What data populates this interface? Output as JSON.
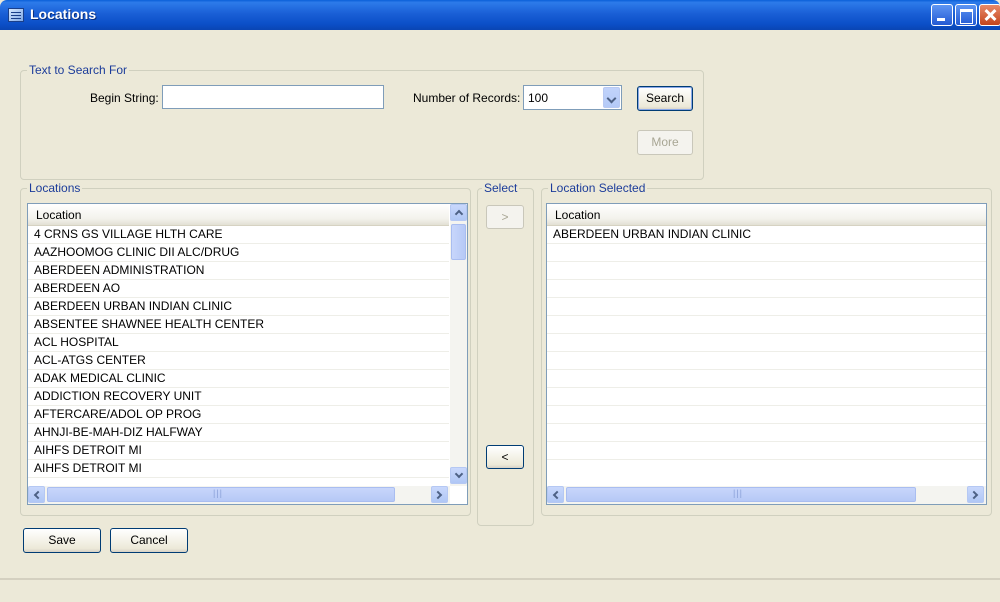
{
  "window": {
    "title": "Locations",
    "icon": "application-icon"
  },
  "search": {
    "group_label": "Text to Search For",
    "begin_label": "Begin String:",
    "begin_value": "",
    "records_label": "Number of Records:",
    "records_value": "100",
    "search_button": "Search",
    "more_button": "More"
  },
  "locations": {
    "group_label": "Locations",
    "column_header": "Location",
    "rows": [
      "4 CRNS GS VILLAGE HLTH CARE",
      "AAZHOOMOG CLINIC DII ALC/DRUG",
      "ABERDEEN ADMINISTRATION",
      "ABERDEEN AO",
      "ABERDEEN URBAN INDIAN CLINIC",
      "ABSENTEE SHAWNEE HEALTH CENTER",
      "ACL HOSPITAL",
      "ACL-ATGS CENTER",
      "ADAK MEDICAL CLINIC",
      "ADDICTION RECOVERY UNIT",
      "AFTERCARE/ADOL OP PROG",
      "AHNJI-BE-MAH-DIZ HALFWAY",
      "AIHFS DETROIT MI",
      "AIHFS DETROIT MI"
    ]
  },
  "select": {
    "group_label": "Select",
    "add_label": ">",
    "remove_label": "<"
  },
  "selected": {
    "group_label": "Location Selected",
    "column_header": "Location",
    "rows": [
      "ABERDEEN URBAN INDIAN CLINIC",
      "",
      "",
      "",
      "",
      "",
      "",
      "",
      "",
      "",
      "",
      "",
      ""
    ]
  },
  "footer": {
    "save_button": "Save",
    "cancel_button": "Cancel"
  },
  "colors": {
    "titlebar": "#0a4fc8",
    "window_bg": "#ece9d8",
    "legend_text": "#1c3c9a"
  }
}
